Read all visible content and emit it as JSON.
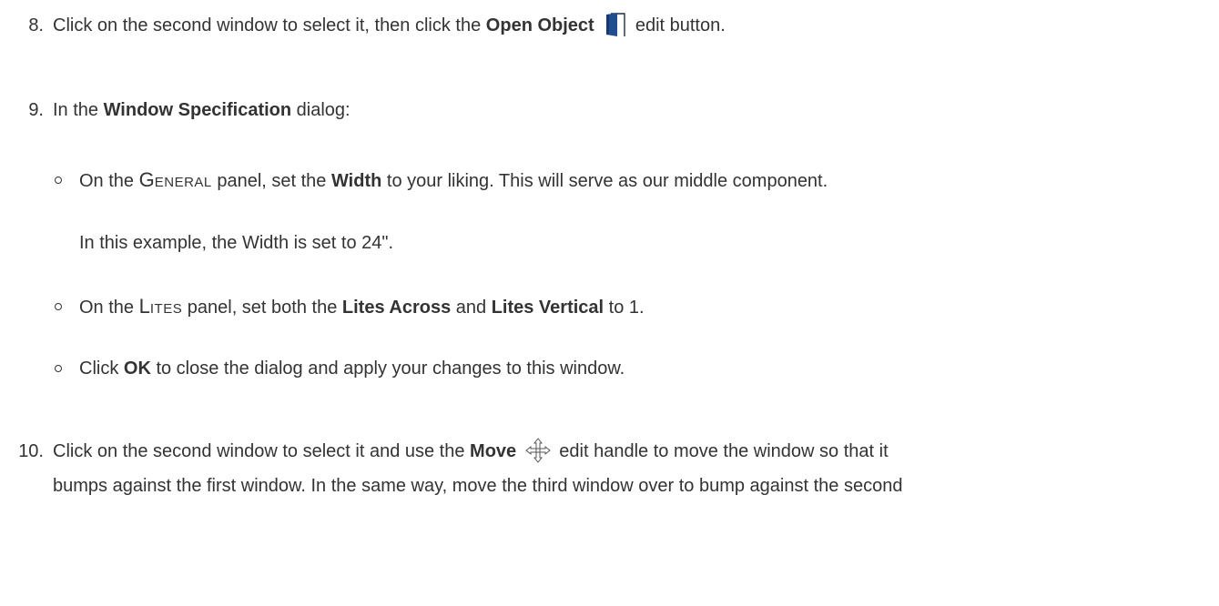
{
  "step8": {
    "number": "8.",
    "pre": "Click on the second window to select it, then click the ",
    "bold": "Open Object",
    "icon": "open-object-icon",
    "post": " edit button."
  },
  "step9": {
    "number": "9.",
    "pre": "In the ",
    "bold": "Window Specification",
    "post": " dialog:",
    "bullets": [
      {
        "pre": "On the ",
        "panel_first": "G",
        "panel_rest": "ENERAL",
        "mid": " panel, set the ",
        "bold": "Width",
        "post": " to your liking. This will serve as our middle component.",
        "note": "In this example, the Width is set to 24\"."
      },
      {
        "pre": "On the ",
        "panel_first": "L",
        "panel_rest": "ITES",
        "mid": " panel, set both the ",
        "bold1": "Lites Across",
        "and": " and ",
        "bold2": "Lites Vertical",
        "post": " to 1."
      },
      {
        "pre": "Click ",
        "bold": "OK",
        "post": " to close the dialog and apply your changes to this window."
      }
    ]
  },
  "step10": {
    "number": "10.",
    "pre": "Click on the second window to select it and use the ",
    "bold": "Move",
    "icon": "move-handle-icon",
    "post": " edit handle to move the window so that it",
    "line2": "bumps against the first window. In the same way, move the third window over to bump against the second"
  },
  "colors": {
    "text": "#333333",
    "icon_blue": "#1f4f8f"
  }
}
